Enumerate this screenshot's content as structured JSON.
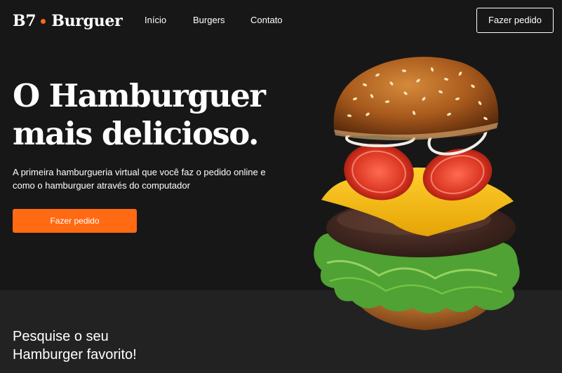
{
  "brand": {
    "name_left": "B7",
    "name_right": "Burguer",
    "accent": "#ff6a13"
  },
  "nav": {
    "items": [
      "Início",
      "Burgers",
      "Contato"
    ]
  },
  "header": {
    "cta_label": "Fazer pedido"
  },
  "hero": {
    "title_line1": "O Hamburguer",
    "title_line2": "mais delicioso.",
    "description": "A primeira hamburgueria virtual que você faz o pedido online e como o hamburguer através do computador",
    "cta_label": "Fazer pedido",
    "image": "flying-burger-image"
  },
  "search_section": {
    "title_line1": "Pesquise o seu",
    "title_line2": "Hamburger favorito!"
  }
}
